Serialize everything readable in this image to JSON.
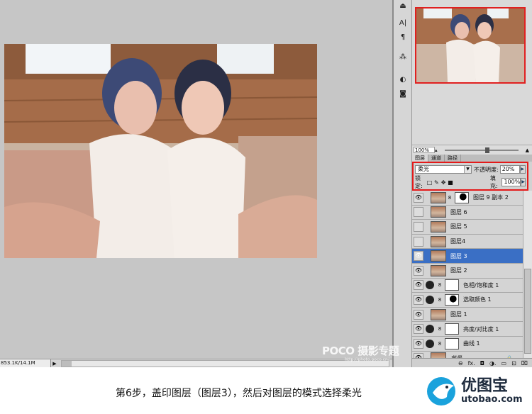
{
  "status": {
    "doc_size": "853.1K/14.1M",
    "arrow": "▶"
  },
  "navigator": {
    "zoom": "100%"
  },
  "layers": {
    "tabs": [
      "图层",
      "通道",
      "路径"
    ],
    "blend_mode": "柔光",
    "opacity_label": "不透明度:",
    "opacity_value": "20%",
    "lock_label": "锁定:",
    "fill_label": "填充:",
    "fill_value": "100%",
    "rows": [
      {
        "name": "图层 9 副本 2",
        "visible": true
      },
      {
        "name": "图层 6",
        "visible": false
      },
      {
        "name": "图层 5",
        "visible": false
      },
      {
        "name": "图层4",
        "visible": false
      },
      {
        "name": "图层 3",
        "visible": true,
        "selected": true
      },
      {
        "name": "图层 2",
        "visible": true
      },
      {
        "name": "色相/饱和度 1",
        "visible": true,
        "adjustment": true
      },
      {
        "name": "选取颜色 1",
        "visible": true,
        "adjustment": true
      },
      {
        "name": "图层 1",
        "visible": true
      },
      {
        "name": "亮度/对比度 1",
        "visible": true,
        "adjustment": true
      },
      {
        "name": "曲线 1",
        "visible": true,
        "adjustment": true
      },
      {
        "name": "背景",
        "visible": true,
        "locked": true
      }
    ]
  },
  "watermark": {
    "text": "POCO 摄影专题",
    "url": "http://photo.poco.cn/"
  },
  "caption": "第6步，盖印图层（图层3），然后对图层的模式选择柔光",
  "logo": {
    "name": "优图宝",
    "url": "utobao.com"
  },
  "colors": {
    "accent_red": "#e41a1a",
    "selected_blue": "#3a6fc5"
  }
}
